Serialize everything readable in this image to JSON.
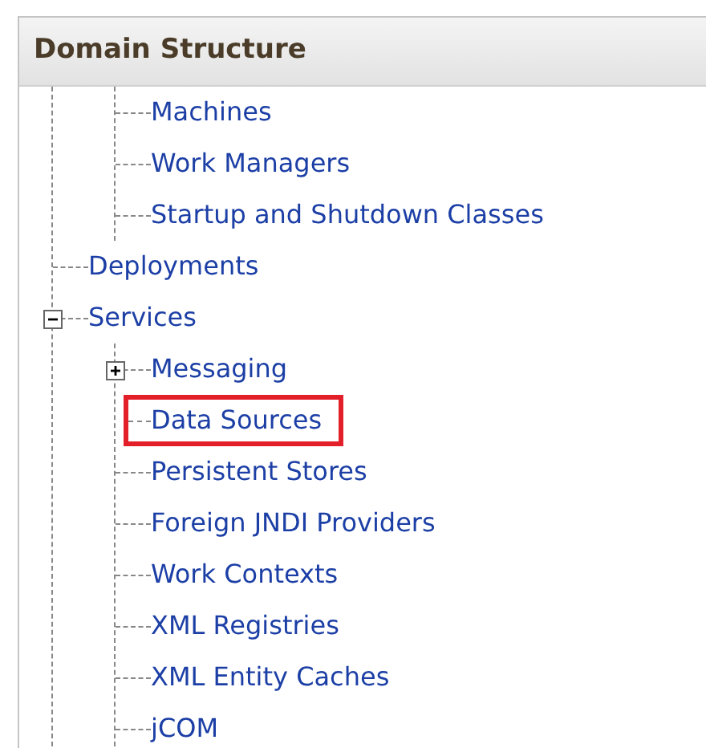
{
  "panel": {
    "title": "Domain Structure"
  },
  "tree": [
    {
      "children": [
        {
          "label": "Machines"
        },
        {
          "label": "Work Managers"
        },
        {
          "label": "Startup and Shutdown Classes"
        }
      ]
    },
    {
      "label": "Deployments"
    },
    {
      "label": "Services",
      "expanded": true,
      "children": [
        {
          "label": "Messaging",
          "expanded": false
        },
        {
          "label": "Data Sources",
          "highlighted": true
        },
        {
          "label": "Persistent Stores"
        },
        {
          "label": "Foreign JNDI Providers"
        },
        {
          "label": "Work Contexts"
        },
        {
          "label": "XML Registries"
        },
        {
          "label": "XML Entity Caches"
        },
        {
          "label": "jCOM"
        }
      ]
    }
  ]
}
